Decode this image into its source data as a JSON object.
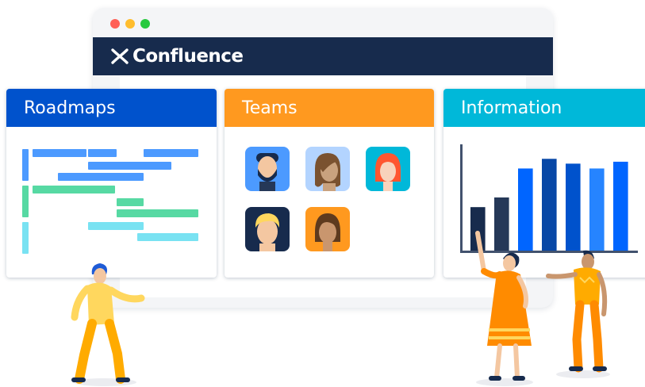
{
  "window": {
    "traffic_lights": [
      "#FF5F56",
      "#FFBD2E",
      "#27C93F"
    ],
    "app_bar_color": "#172B4D"
  },
  "brand": {
    "name": "Confluence",
    "icon": "confluence-logo-icon"
  },
  "cards": {
    "roadmaps": {
      "title": "Roadmaps",
      "color": "#0052CC"
    },
    "teams": {
      "title": "Teams",
      "color": "#FF991F"
    },
    "information": {
      "title": "Information",
      "color": "#00B8D9"
    }
  },
  "team_avatars": [
    {
      "name": "man-beard-avatar-icon",
      "bg": "#4C9AFF"
    },
    {
      "name": "woman-brown-hair-avatar-icon",
      "bg": "#B3D4FF"
    },
    {
      "name": "woman-red-hair-avatar-icon",
      "bg": "#00B8D9"
    },
    {
      "name": "man-blonde-hair-avatar-icon",
      "bg": "#172B4D"
    },
    {
      "name": "woman-dark-hair-avatar-icon",
      "bg": "#FF991F"
    }
  ],
  "chart_data": {
    "type": "bar",
    "title": "",
    "xlabel": "",
    "ylabel": "",
    "values": [
      4.5,
      5.5,
      8.5,
      9.5,
      9,
      8.5,
      9.2
    ],
    "ylim": [
      0,
      11
    ],
    "grid": false,
    "colors": [
      "#172B4D",
      "#253858",
      "#0065FF",
      "#0747A6",
      "#0052CC",
      "#2684FF",
      "#0065FF"
    ]
  }
}
